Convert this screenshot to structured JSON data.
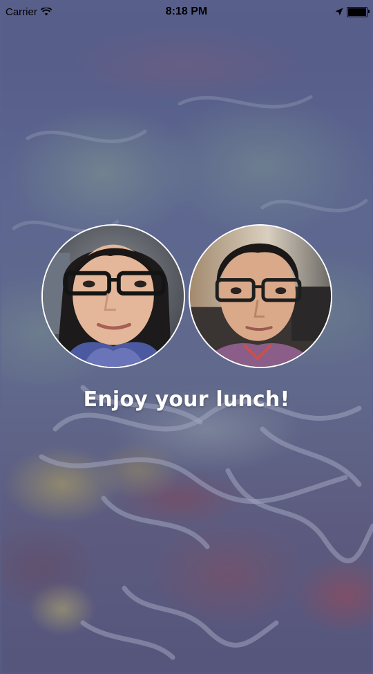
{
  "status_bar": {
    "carrier": "Carrier",
    "time": "8:18 PM",
    "battery_level": 1.0,
    "icons": [
      "wifi-icon",
      "location-arrow-icon",
      "battery-icon"
    ]
  },
  "avatars": [
    {
      "name": "avatar-woman",
      "description_icon": "person-avatar"
    },
    {
      "name": "avatar-man",
      "description_icon": "person-avatar"
    }
  ],
  "message": "Enjoy your lunch!",
  "colors": {
    "overlay": "#4e568c",
    "text": "#ffffff",
    "avatar_border": "#ffffff"
  }
}
